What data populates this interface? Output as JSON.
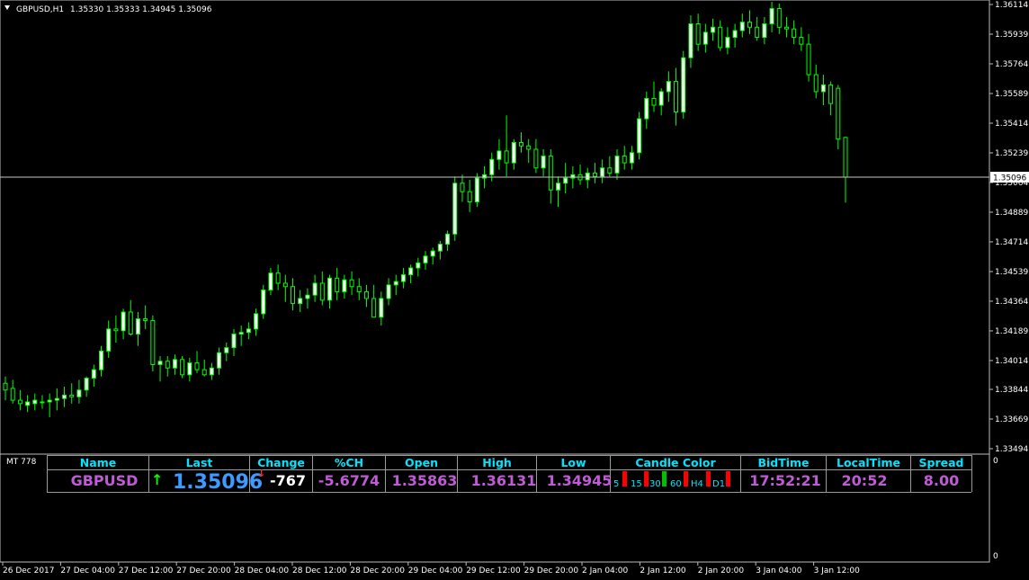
{
  "header": {
    "symbol": "GBPUSD,H1",
    "ohlc": "1.35330 1.35333 1.34945 1.35096"
  },
  "chart_data": {
    "type": "candlestick",
    "ylim": [
      1.3344,
      1.3616
    ],
    "price_ticks": [
      "1.36114",
      "1.35939",
      "1.35764",
      "1.35589",
      "1.35414",
      "1.35239",
      "1.35064",
      "1.34889",
      "1.34714",
      "1.34539",
      "1.34364",
      "1.34189",
      "1.34014",
      "1.33844",
      "1.33669",
      "1.33494"
    ],
    "price_tick_values": [
      1.36114,
      1.35939,
      1.35764,
      1.35589,
      1.35414,
      1.35239,
      1.35064,
      1.34889,
      1.34714,
      1.34539,
      1.34364,
      1.34189,
      1.34014,
      1.33844,
      1.33669,
      1.33494
    ],
    "current_price": "1.35096",
    "current_price_value": 1.35096,
    "time_ticks": [
      "26 Dec 2017",
      "27 Dec 04:00",
      "27 Dec 12:00",
      "27 Dec 20:00",
      "28 Dec 04:00",
      "28 Dec 12:00",
      "28 Dec 20:00",
      "29 Dec 04:00",
      "29 Dec 12:00",
      "29 Dec 20:00",
      "2 Jan 04:00",
      "2 Jan 12:00",
      "2 Jan 20:00",
      "3 Jan 04:00",
      "3 Jan 12:00"
    ],
    "candles": [
      [
        1.3388,
        1.3392,
        1.3378,
        1.3384
      ],
      [
        1.3385,
        1.339,
        1.3376,
        1.3378
      ],
      [
        1.3378,
        1.3384,
        1.3372,
        1.3376
      ],
      [
        1.3375,
        1.3381,
        1.3371,
        1.3377
      ],
      [
        1.3376,
        1.3382,
        1.3372,
        1.3378
      ],
      [
        1.3377,
        1.3381,
        1.3373,
        1.3377
      ],
      [
        1.3377,
        1.3382,
        1.3368,
        1.3378
      ],
      [
        1.3378,
        1.3385,
        1.3372,
        1.3379
      ],
      [
        1.3379,
        1.3386,
        1.3374,
        1.3381
      ],
      [
        1.3381,
        1.3388,
        1.3376,
        1.338
      ],
      [
        1.338,
        1.339,
        1.3376,
        1.3384
      ],
      [
        1.3384,
        1.3392,
        1.338,
        1.3391
      ],
      [
        1.3391,
        1.3399,
        1.3386,
        1.3396
      ],
      [
        1.3396,
        1.341,
        1.3392,
        1.3407
      ],
      [
        1.3407,
        1.3425,
        1.3403,
        1.342
      ],
      [
        1.342,
        1.3428,
        1.3412,
        1.3419
      ],
      [
        1.3419,
        1.3432,
        1.3414,
        1.343
      ],
      [
        1.343,
        1.3437,
        1.3416,
        1.3417
      ],
      [
        1.3417,
        1.343,
        1.341,
        1.3426
      ],
      [
        1.3426,
        1.3434,
        1.342,
        1.3425
      ],
      [
        1.3425,
        1.3428,
        1.3395,
        1.3399
      ],
      [
        1.3399,
        1.3404,
        1.3389,
        1.3401
      ],
      [
        1.3401,
        1.3404,
        1.3392,
        1.3397
      ],
      [
        1.3397,
        1.3405,
        1.3393,
        1.3402
      ],
      [
        1.3402,
        1.3404,
        1.3391,
        1.3393
      ],
      [
        1.3393,
        1.3403,
        1.3389,
        1.34
      ],
      [
        1.34,
        1.3407,
        1.3394,
        1.3396
      ],
      [
        1.3396,
        1.3402,
        1.3392,
        1.3393
      ],
      [
        1.3393,
        1.34,
        1.339,
        1.3397
      ],
      [
        1.3397,
        1.3409,
        1.3393,
        1.3406
      ],
      [
        1.3406,
        1.3412,
        1.3401,
        1.3409
      ],
      [
        1.3409,
        1.342,
        1.3404,
        1.3417
      ],
      [
        1.3417,
        1.3422,
        1.341,
        1.3418
      ],
      [
        1.3418,
        1.3424,
        1.3414,
        1.342
      ],
      [
        1.342,
        1.3432,
        1.3416,
        1.3429
      ],
      [
        1.3429,
        1.3446,
        1.3426,
        1.3443
      ],
      [
        1.3443,
        1.3456,
        1.344,
        1.3453
      ],
      [
        1.3453,
        1.3458,
        1.3443,
        1.3447
      ],
      [
        1.3447,
        1.3452,
        1.3436,
        1.3445
      ],
      [
        1.3445,
        1.345,
        1.3431,
        1.3435
      ],
      [
        1.3435,
        1.3443,
        1.343,
        1.3438
      ],
      [
        1.3438,
        1.3444,
        1.3432,
        1.344
      ],
      [
        1.344,
        1.3452,
        1.3436,
        1.3447
      ],
      [
        1.3447,
        1.3454,
        1.3434,
        1.3437
      ],
      [
        1.3437,
        1.3452,
        1.3432,
        1.345
      ],
      [
        1.345,
        1.3456,
        1.3437,
        1.3442
      ],
      [
        1.3442,
        1.3452,
        1.3438,
        1.3449
      ],
      [
        1.3449,
        1.3454,
        1.344,
        1.3445
      ],
      [
        1.3445,
        1.345,
        1.3437,
        1.3442
      ],
      [
        1.3442,
        1.3446,
        1.3433,
        1.3438
      ],
      [
        1.3438,
        1.3446,
        1.3427,
        1.3427
      ],
      [
        1.3427,
        1.3442,
        1.3422,
        1.3438
      ],
      [
        1.3438,
        1.345,
        1.3434,
        1.3446
      ],
      [
        1.3446,
        1.3452,
        1.344,
        1.3448
      ],
      [
        1.3448,
        1.3456,
        1.3444,
        1.3452
      ],
      [
        1.3452,
        1.3458,
        1.3447,
        1.3456
      ],
      [
        1.3456,
        1.3462,
        1.3451,
        1.3459
      ],
      [
        1.3459,
        1.3466,
        1.3455,
        1.3463
      ],
      [
        1.3463,
        1.3468,
        1.3458,
        1.3466
      ],
      [
        1.3466,
        1.3472,
        1.3461,
        1.347
      ],
      [
        1.347,
        1.3478,
        1.3466,
        1.3476
      ],
      [
        1.3476,
        1.351,
        1.3472,
        1.3506
      ],
      [
        1.3506,
        1.3511,
        1.3495,
        1.3501
      ],
      [
        1.3501,
        1.3508,
        1.3489,
        1.3495
      ],
      [
        1.3495,
        1.3512,
        1.3492,
        1.3509
      ],
      [
        1.3509,
        1.3516,
        1.3503,
        1.3511
      ],
      [
        1.3511,
        1.3524,
        1.3507,
        1.352
      ],
      [
        1.352,
        1.3532,
        1.3514,
        1.3525
      ],
      [
        1.3525,
        1.3546,
        1.351,
        1.3518
      ],
      [
        1.3518,
        1.3532,
        1.3514,
        1.353
      ],
      [
        1.353,
        1.3536,
        1.3524,
        1.3528
      ],
      [
        1.3528,
        1.3532,
        1.3518,
        1.3526
      ],
      [
        1.3526,
        1.3532,
        1.3512,
        1.3515
      ],
      [
        1.3515,
        1.3526,
        1.351,
        1.3522
      ],
      [
        1.3522,
        1.3526,
        1.3494,
        1.3502
      ],
      [
        1.3502,
        1.351,
        1.3492,
        1.3506
      ],
      [
        1.3506,
        1.3518,
        1.35,
        1.3509
      ],
      [
        1.3509,
        1.3516,
        1.3503,
        1.3511
      ],
      [
        1.3511,
        1.3517,
        1.3505,
        1.3508
      ],
      [
        1.3508,
        1.3515,
        1.3503,
        1.3512
      ],
      [
        1.3512,
        1.3518,
        1.3506,
        1.351
      ],
      [
        1.351,
        1.352,
        1.3506,
        1.3515
      ],
      [
        1.3515,
        1.3522,
        1.351,
        1.3512
      ],
      [
        1.3512,
        1.3526,
        1.3508,
        1.3522
      ],
      [
        1.3522,
        1.3528,
        1.3514,
        1.3518
      ],
      [
        1.3518,
        1.3528,
        1.3514,
        1.3524
      ],
      [
        1.3524,
        1.3548,
        1.352,
        1.3544
      ],
      [
        1.3544,
        1.356,
        1.3538,
        1.3556
      ],
      [
        1.3556,
        1.3566,
        1.3548,
        1.3552
      ],
      [
        1.3552,
        1.3562,
        1.3546,
        1.356
      ],
      [
        1.356,
        1.3572,
        1.3554,
        1.3566
      ],
      [
        1.3566,
        1.3574,
        1.354,
        1.3548
      ],
      [
        1.3548,
        1.3584,
        1.3544,
        1.358
      ],
      [
        1.358,
        1.3605,
        1.3574,
        1.36
      ],
      [
        1.36,
        1.3606,
        1.3584,
        1.3588
      ],
      [
        1.3588,
        1.36,
        1.3583,
        1.3595
      ],
      [
        1.3595,
        1.3603,
        1.359,
        1.3598
      ],
      [
        1.3598,
        1.3602,
        1.3584,
        1.3586
      ],
      [
        1.3586,
        1.3598,
        1.3582,
        1.3592
      ],
      [
        1.3592,
        1.36,
        1.3586,
        1.3596
      ],
      [
        1.3596,
        1.3606,
        1.3592,
        1.3601
      ],
      [
        1.3601,
        1.3608,
        1.3594,
        1.3598
      ],
      [
        1.3598,
        1.3604,
        1.359,
        1.3592
      ],
      [
        1.3592,
        1.3604,
        1.3588,
        1.36
      ],
      [
        1.36,
        1.3613,
        1.3595,
        1.3609
      ],
      [
        1.3609,
        1.3612,
        1.3594,
        1.3598
      ],
      [
        1.3598,
        1.3604,
        1.3592,
        1.3597
      ],
      [
        1.3597,
        1.3602,
        1.3588,
        1.3592
      ],
      [
        1.3592,
        1.3598,
        1.3584,
        1.3588
      ],
      [
        1.3588,
        1.3594,
        1.3566,
        1.357
      ],
      [
        1.357,
        1.3576,
        1.3556,
        1.356
      ],
      [
        1.356,
        1.357,
        1.3552,
        1.3564
      ],
      [
        1.3564,
        1.3566,
        1.3546,
        1.3553
      ],
      [
        1.3562,
        1.3564,
        1.3526,
        1.3532
      ],
      [
        1.3533,
        1.35333,
        1.34945,
        1.35096
      ]
    ]
  },
  "panel": {
    "label": "MT 778",
    "headers": [
      "Name",
      "Last",
      "Change",
      "%CH",
      "Open",
      "High",
      "Low",
      "Candle Color",
      "BidTime",
      "LocalTime",
      "Spread"
    ],
    "values": {
      "name": "GBPUSD",
      "last": "1.35096",
      "change": "-767",
      "pct_change": "-5.6774",
      "open": "1.35863",
      "high": "1.36131",
      "low": "1.34945",
      "bid_time": "17:52:21",
      "local_time": "20:52",
      "spread": "8.00"
    },
    "candle_colors": [
      {
        "tf": "5",
        "color": "#ff0000"
      },
      {
        "tf": "15",
        "color": "#ff0000"
      },
      {
        "tf": "30",
        "color": "#00c000"
      },
      {
        "tf": "60",
        "color": "#ff0000"
      },
      {
        "tf": "H4",
        "color": "#ff0000"
      },
      {
        "tf": "D1",
        "color": "#ff0000"
      }
    ],
    "scale_top": "0",
    "scale_bottom": "0"
  },
  "colors": {
    "background": "#000000",
    "candle_up_fill": "#ffffff",
    "candle_wick": "#00ff00",
    "accent_cyan": "#00e5ff",
    "value_purple": "#c05bd6",
    "last_blue": "#3d9bff"
  }
}
